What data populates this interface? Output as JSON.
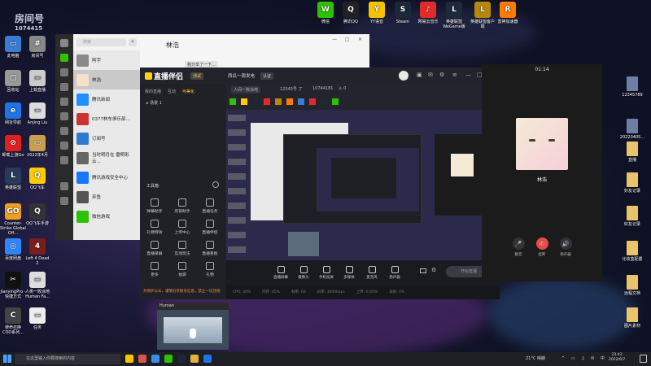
{
  "desktop": {
    "top_icons": [
      {
        "label": "微信",
        "color": "#2dc100",
        "glyph": "W"
      },
      {
        "label": "腾讯QQ",
        "color": "#222222",
        "glyph": "Q"
      },
      {
        "label": "YY语音",
        "color": "#f5c400",
        "glyph": "Y"
      },
      {
        "label": "Steam",
        "color": "#1b2838",
        "glyph": "S"
      },
      {
        "label": "网易云音乐",
        "color": "#e22a2a",
        "glyph": "♪"
      },
      {
        "label": "英雄联盟 WeGame版",
        "color": "#1d2a3a",
        "glyph": "L"
      },
      {
        "label": "英雄联盟客户端",
        "color": "#b8860b",
        "glyph": "L"
      },
      {
        "label": "雷神加速器",
        "color": "#ff7a00",
        "glyph": "R"
      }
    ],
    "left_icons": [
      {
        "label": "此电脑",
        "color": "#3a7bd5",
        "glyph": "▭"
      },
      {
        "label": "房间号",
        "color": "#888888",
        "glyph": "#"
      },
      {
        "label": "回收站",
        "color": "#999999",
        "glyph": "▢"
      },
      {
        "label": "上载直播",
        "color": "#cccccc",
        "glyph": "▭"
      },
      {
        "label": "网址导航",
        "color": "#1e73e8",
        "glyph": "e"
      },
      {
        "label": "Anjing Liu",
        "color": "#dddddd",
        "glyph": "▭"
      },
      {
        "label": "卸载上游Go",
        "color": "#e02020",
        "glyph": "⊘"
      },
      {
        "label": "2022年4月",
        "color": "#c8a050",
        "glyph": "▭"
      },
      {
        "label": "英雄联盟",
        "color": "#2a3a5a",
        "glyph": "L"
      },
      {
        "label": "QQ飞车",
        "color": "#ffcc00",
        "glyph": "Q"
      },
      {
        "label": "Counter-Strike Global Off...",
        "color": "#f0a020",
        "glyph": "GO"
      },
      {
        "label": "QQ飞车手游",
        "color": "#333333",
        "glyph": "Q"
      },
      {
        "label": "百度网盘",
        "color": "#2e86ff",
        "glyph": "◎"
      },
      {
        "label": "Left 4 Dead 2",
        "color": "#7a1d1d",
        "glyph": "4"
      },
      {
        "label": "JianyingPro - 快捷方式",
        "color": "#111111",
        "glyph": "✂"
      },
      {
        "label": "人类一败涂地 Human Fa...",
        "color": "#dddddd",
        "glyph": "▭"
      },
      {
        "label": "使命召唤 COD系列...",
        "color": "#444444",
        "glyph": "C"
      },
      {
        "label": "任务",
        "color": "#eeeeee",
        "glyph": "▭"
      }
    ],
    "right_icons": [
      {
        "label": "12345789"
      },
      {
        "label": "20220405..."
      },
      {
        "label": "直播"
      },
      {
        "label": "好友记录"
      },
      {
        "label": "好友记录"
      },
      {
        "label": "化妆盒配置"
      },
      {
        "label": "远程文档"
      },
      {
        "label": "图片素材"
      }
    ],
    "watermark": "房间号",
    "room_number": "1074415"
  },
  "wechat": {
    "search_placeholder": "搜索",
    "plus": "+",
    "chat_title": "林浩",
    "last_message": "我分享了一下...",
    "window_controls": [
      "—",
      "□",
      "✕"
    ],
    "contacts": [
      {
        "name": "阿宇",
        "color": "#8a8a8a"
      },
      {
        "name": "林浩",
        "color": "#f4e2c8"
      },
      {
        "name": "腾讯新闻",
        "color": "#1e90ff"
      },
      {
        "name": "0377林车俱乐部...",
        "color": "#cc3333"
      },
      {
        "name": "订阅号",
        "color": "#2e7ad1"
      },
      {
        "name": "当时明月在 雷明彩云...",
        "color": "#666666"
      },
      {
        "name": "腾讯游戏安全中心",
        "color": "#1677ff"
      },
      {
        "name": "弃鱼",
        "color": "#555555"
      },
      {
        "name": "微信游戏",
        "color": "#2dc100"
      }
    ]
  },
  "live": {
    "app_name": "直播伴侣",
    "version_tag": "测试",
    "streamer_name": "西瓜一周发电",
    "badge": "认证",
    "subtitle_tag": "人间一败涂地",
    "room_label": "12345号 了",
    "room_id": "10744181",
    "viewers": "0",
    "left_tabs": [
      "我的直播",
      "互动",
      "可美化"
    ],
    "scene_label": "场景 1",
    "tools_title": "工具箱",
    "tools": [
      {
        "label": "弹幕助手"
      },
      {
        "label": "房管助手"
      },
      {
        "label": "直播任务"
      },
      {
        "label": "礼物特效"
      },
      {
        "label": "上传中心"
      },
      {
        "label": "直播伴侣"
      },
      {
        "label": "直播录屏"
      },
      {
        "label": "互动玩法"
      },
      {
        "label": "直播看板"
      },
      {
        "label": "更多"
      },
      {
        "label": "福袋"
      },
      {
        "label": "礼物"
      }
    ],
    "bottom_tools": [
      {
        "label": "直播屏幕"
      },
      {
        "label": "摄像头"
      },
      {
        "label": "手机投屏"
      },
      {
        "label": "多媒体"
      },
      {
        "label": "麦克风"
      },
      {
        "label": "扬声器"
      }
    ],
    "start_button": "开始直播",
    "status": [
      "CPU: 30%",
      "内存: 45%",
      "帧率: 60",
      "码率: 3000kbps",
      "上传: 0.00%",
      "丢帧: 0%"
    ],
    "warning": "为保护公众，谨慎分享账号信息，禁止一切违规"
  },
  "call": {
    "timer": "01:14",
    "name": "林浩",
    "buttons": [
      {
        "label": "静音",
        "color": "#333333",
        "glyph": "🎤"
      },
      {
        "label": "挂断",
        "color": "#e84a4a",
        "glyph": "✆"
      },
      {
        "label": "扬声器",
        "color": "#333333",
        "glyph": "🔊"
      }
    ]
  },
  "game": {
    "title": "Human"
  },
  "taskbar": {
    "search_placeholder": "在这里输入你要搜索的内容",
    "weather": "21°C 晴朗",
    "time": "23:43",
    "date": "2022/6/7",
    "apps": [
      {
        "color": "#f6c700"
      },
      {
        "color": "#d9534f"
      },
      {
        "color": "#3a8ee6"
      },
      {
        "color": "#2dc100"
      },
      {
        "color": "#1b2838"
      },
      {
        "color": "#e2b13c"
      },
      {
        "color": "#1e73e8"
      }
    ]
  }
}
